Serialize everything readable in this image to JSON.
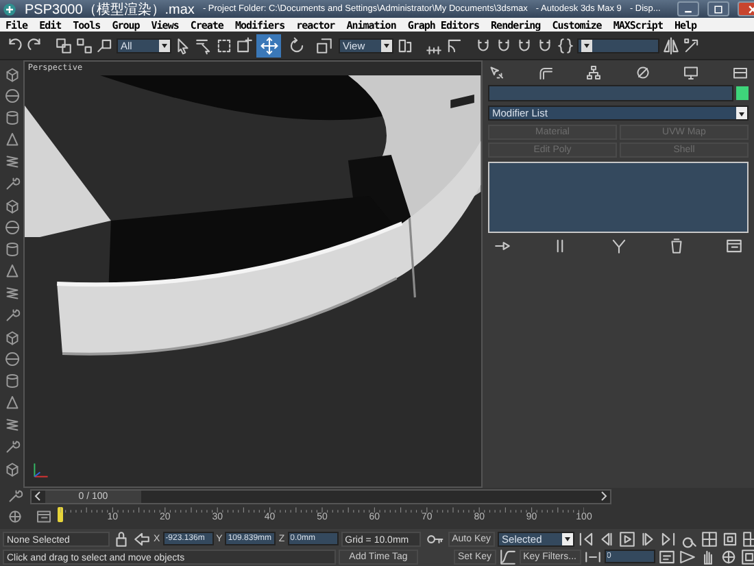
{
  "window": {
    "title_parts": [
      "PSP3000（模型渲染）.max",
      "- Project Folder: C:\\Documents and Settings\\Administrator\\My Documents\\3dsmax",
      "- Autodesk 3ds Max 9",
      "- Disp..."
    ]
  },
  "menu": [
    "File",
    "Edit",
    "Tools",
    "Group",
    "Views",
    "Create",
    "Modifiers",
    "reactor",
    "Animation",
    "Graph Editors",
    "Rendering",
    "Customize",
    "MAXScript",
    "Help"
  ],
  "toolbar": {
    "selection_filter": "All",
    "transform_tools": [
      {
        "selected": true
      },
      {
        "selected": false
      },
      {
        "selected": false
      }
    ],
    "reference_coordinate_system": "View"
  },
  "viewport": {
    "label": "Perspective"
  },
  "command_panel": {
    "modifier_list": "Modifier List",
    "modifier_buttons": [
      {
        "label": "Material",
        "disabled": true
      },
      {
        "label": "UVW Map",
        "disabled": true
      },
      {
        "label": "Edit Poly",
        "disabled": true
      },
      {
        "label": "Shell",
        "disabled": true
      }
    ]
  },
  "time_slider": {
    "label": "0 / 100",
    "level": 0
  },
  "track_bar": {
    "ticks": [
      "10",
      "20",
      "30",
      "40",
      "50",
      "60",
      "70",
      "80",
      "90",
      "100"
    ]
  },
  "status": {
    "selection": "None Selected",
    "prompt": "Click and drag to select and move objects",
    "x_label": "X",
    "x_value": "-923.136m",
    "y_label": "Y",
    "y_value": "109.839mm",
    "z_label": "Z",
    "z_value": "0.0mm",
    "grid": "Grid = 10.0mm",
    "add_time_tag": "Add Time Tag"
  },
  "animation": {
    "auto_key": "Auto Key",
    "key_mode_filter": "Selected",
    "set_key": "Set Key",
    "key_filters": "Key Filters...",
    "current_frame": "0"
  }
}
